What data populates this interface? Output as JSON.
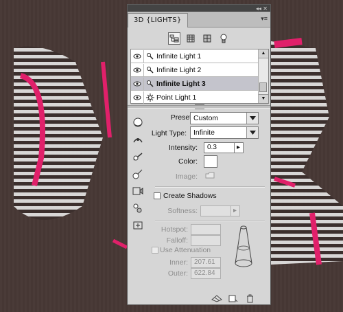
{
  "panel": {
    "tab_title": "3D {LIGHTS}",
    "top_arrows": "◂◂ ✕",
    "menu_glyph": "▾≡",
    "filter_icons": [
      "scene-filter-icon",
      "mesh-filter-icon",
      "material-filter-icon",
      "light-filter-icon"
    ]
  },
  "lights": [
    {
      "label": "Infinite Light 1",
      "icon": "infinite-light-icon",
      "selected": false
    },
    {
      "label": "Infinite Light 2",
      "icon": "infinite-light-icon",
      "selected": false
    },
    {
      "label": "Infinite Light 3",
      "icon": "infinite-light-icon",
      "selected": true
    },
    {
      "label": "Point Light 1",
      "icon": "point-light-icon",
      "selected": false
    }
  ],
  "props": {
    "preset_label": "Preset:",
    "preset_value": "Custom",
    "light_type_label": "Light Type:",
    "light_type_value": "Infinite",
    "intensity_label": "Intensity:",
    "intensity_value": "0.3",
    "color_label": "Color:",
    "color_value": "#ffffff",
    "image_label": "Image:",
    "create_shadows_label": "Create Shadows",
    "softness_label": "Softness:",
    "hotspot_label": "Hotspot:",
    "falloff_label": "Falloff:",
    "use_attenuation_label": "Use Attenuation",
    "inner_label": "Inner:",
    "inner_value": "207.61",
    "outer_label": "Outer:",
    "outer_value": "622.84"
  },
  "colors": {
    "accent_pink": "#e0206a",
    "panel_bg": "#d6d6d6",
    "selected_row": "#c4c4cc"
  }
}
